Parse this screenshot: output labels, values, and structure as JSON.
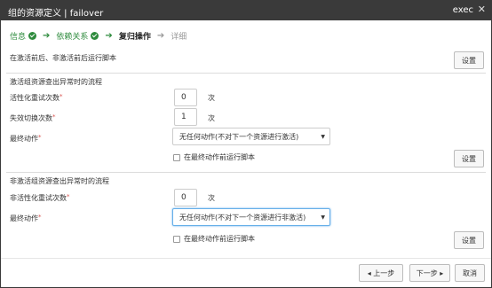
{
  "window": {
    "title": "组的资源定义 | failover",
    "right_label": "exec",
    "close_glyph": "✕"
  },
  "steps": [
    {
      "label": "信息",
      "state": "done"
    },
    {
      "label": "依赖关系",
      "state": "done"
    },
    {
      "label": "复归操作",
      "state": "active"
    },
    {
      "label": "详细",
      "state": "pending"
    }
  ],
  "top": {
    "description": "在激活前后、非激活前后运行脚本",
    "settings_label": "设置"
  },
  "activation": {
    "title": "激活组资源查出异常时的流程",
    "retry_label": "活性化重试次数",
    "retry_value": "0",
    "failover_label": "失效切换次数",
    "failover_value": "1",
    "unit": "次",
    "final_action_label": "最终动作",
    "final_action_value": "无任何动作(不对下一个资源进行激活)",
    "checkbox_label": "在最终动作前运行脚本",
    "checkbox_checked": false,
    "settings_label": "设置"
  },
  "deactivation": {
    "title": "非激活组资源查出异常时的流程",
    "retry_label": "非活性化重试次数",
    "retry_value": "0",
    "unit": "次",
    "final_action_label": "最终动作",
    "final_action_value": "无任何动作(不对下一个资源进行非激活)",
    "checkbox_label": "在最终动作前运行脚本",
    "checkbox_checked": false,
    "settings_label": "设置"
  },
  "footer": {
    "prev_label": "◂ 上一步",
    "next_label": "下一步 ▸",
    "cancel_label": "取消"
  },
  "required_mark": "*",
  "colors": {
    "titlebar": "#3a3a3a",
    "step_done": "#2e8b3d",
    "required": "#d9534f",
    "focus": "#66afe9"
  }
}
